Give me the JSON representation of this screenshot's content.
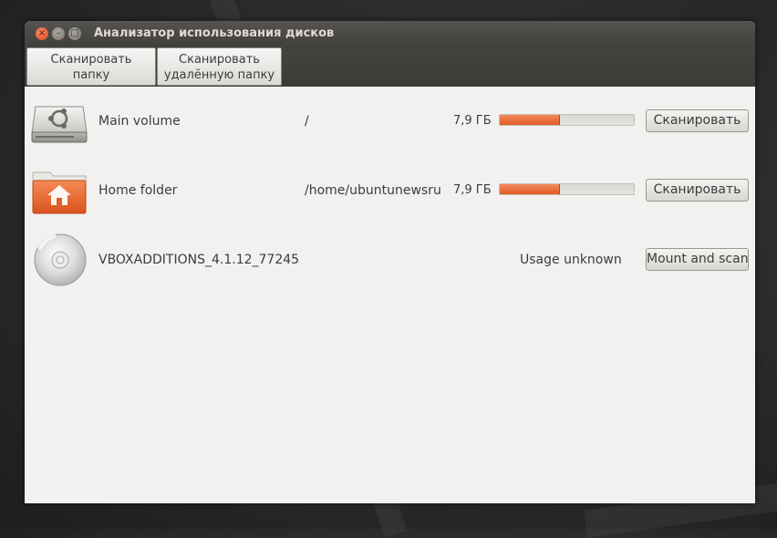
{
  "window": {
    "title": "Анализатор использования дисков",
    "buttons": {
      "close": "×",
      "minimize": "–",
      "maximize": "□"
    }
  },
  "toolbar": {
    "scan_folder": {
      "line1": "Сканировать",
      "line2": "папку"
    },
    "scan_remote": {
      "line1": "Сканировать",
      "line2": "удалённую папку"
    }
  },
  "devices": [
    {
      "name": "Main volume",
      "path": "/",
      "size": "7,9 ГБ",
      "usage": 0.45,
      "button": "Сканировать",
      "icon": "hard-drive-icon"
    },
    {
      "name": "Home folder",
      "path": "/home/ubuntunewsru",
      "size": "7,9 ГБ",
      "usage": 0.45,
      "button": "Сканировать",
      "icon": "home-folder-icon"
    },
    {
      "name": "VBOXADDITIONS_4.1.12_77245",
      "status": "Usage unknown",
      "button": "Mount and scan",
      "icon": "optical-disc-icon"
    }
  ],
  "colors": {
    "accent": "#e05a23",
    "titlebar": "#403f3b",
    "background": "#f2f1f0"
  }
}
